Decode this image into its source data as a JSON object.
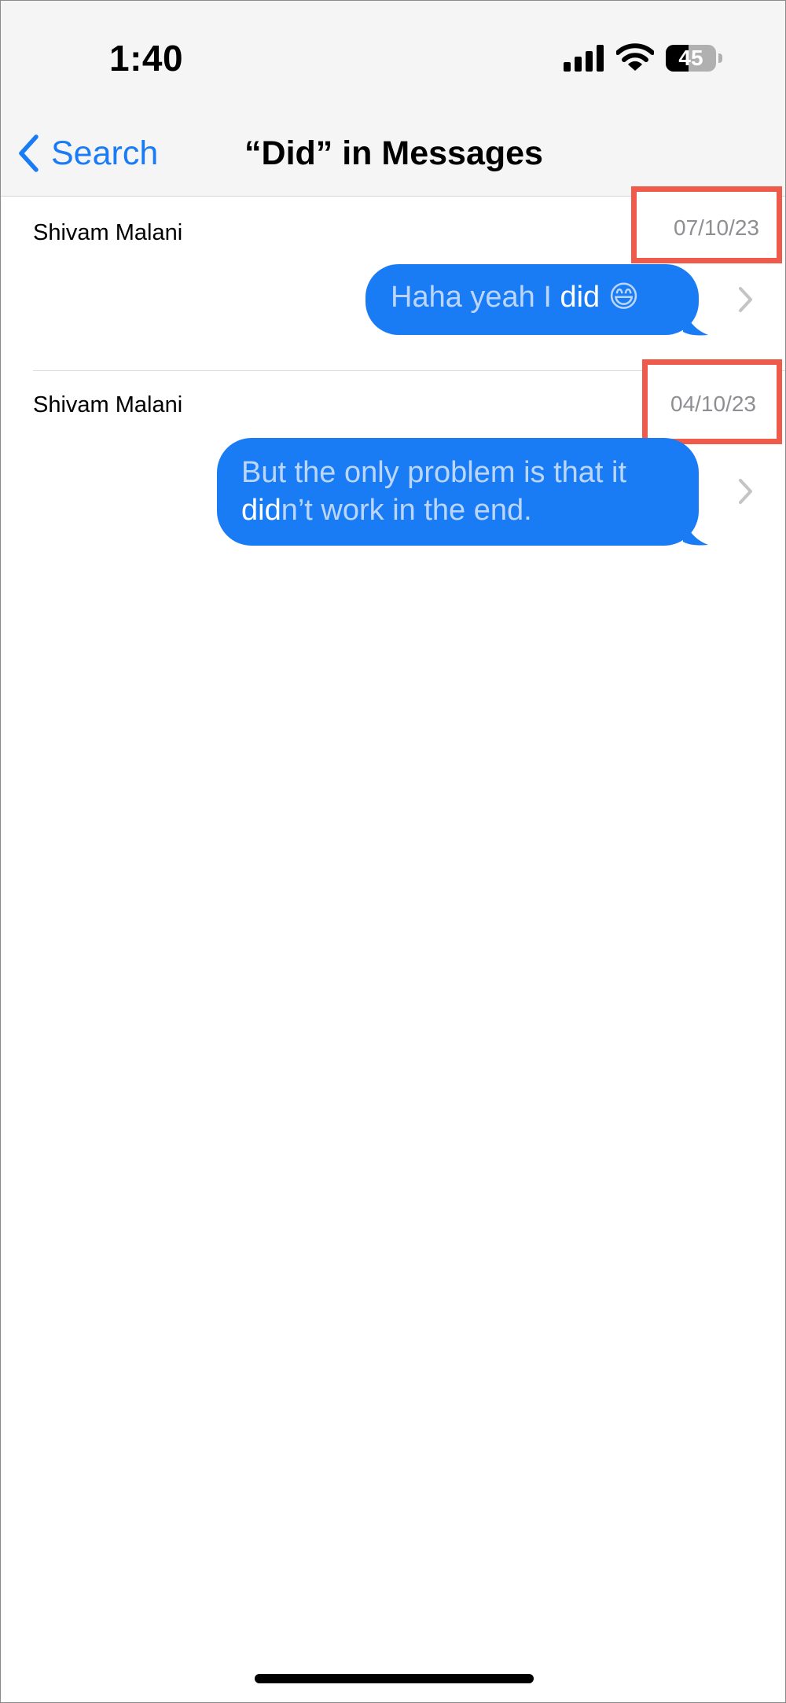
{
  "status_bar": {
    "time": "1:40",
    "battery_level": "45",
    "battery_fraction": 0.45,
    "icons": [
      "cellular-signal-icon",
      "wifi-icon",
      "battery-icon"
    ]
  },
  "nav": {
    "back_label": "Search",
    "back_icon": "chevron-left-icon",
    "title": "“Did” in Messages"
  },
  "results": [
    {
      "sender": "Shivam Malani",
      "date": "07/10/23",
      "message": {
        "before": "Haha yeah I ",
        "match": "did",
        "emoji": " 😄",
        "after": ""
      }
    },
    {
      "sender": "Shivam Malani",
      "date": "04/10/23",
      "message": {
        "line1": "But the only problem is that it",
        "match": "did",
        "after": "n’t work in the end."
      }
    }
  ],
  "colors": {
    "accent": "#1a7cf5",
    "bubble_text_dim": "#bcd6fb",
    "highlight_box": "#ef5a4b",
    "date_text": "#8e8e93"
  }
}
